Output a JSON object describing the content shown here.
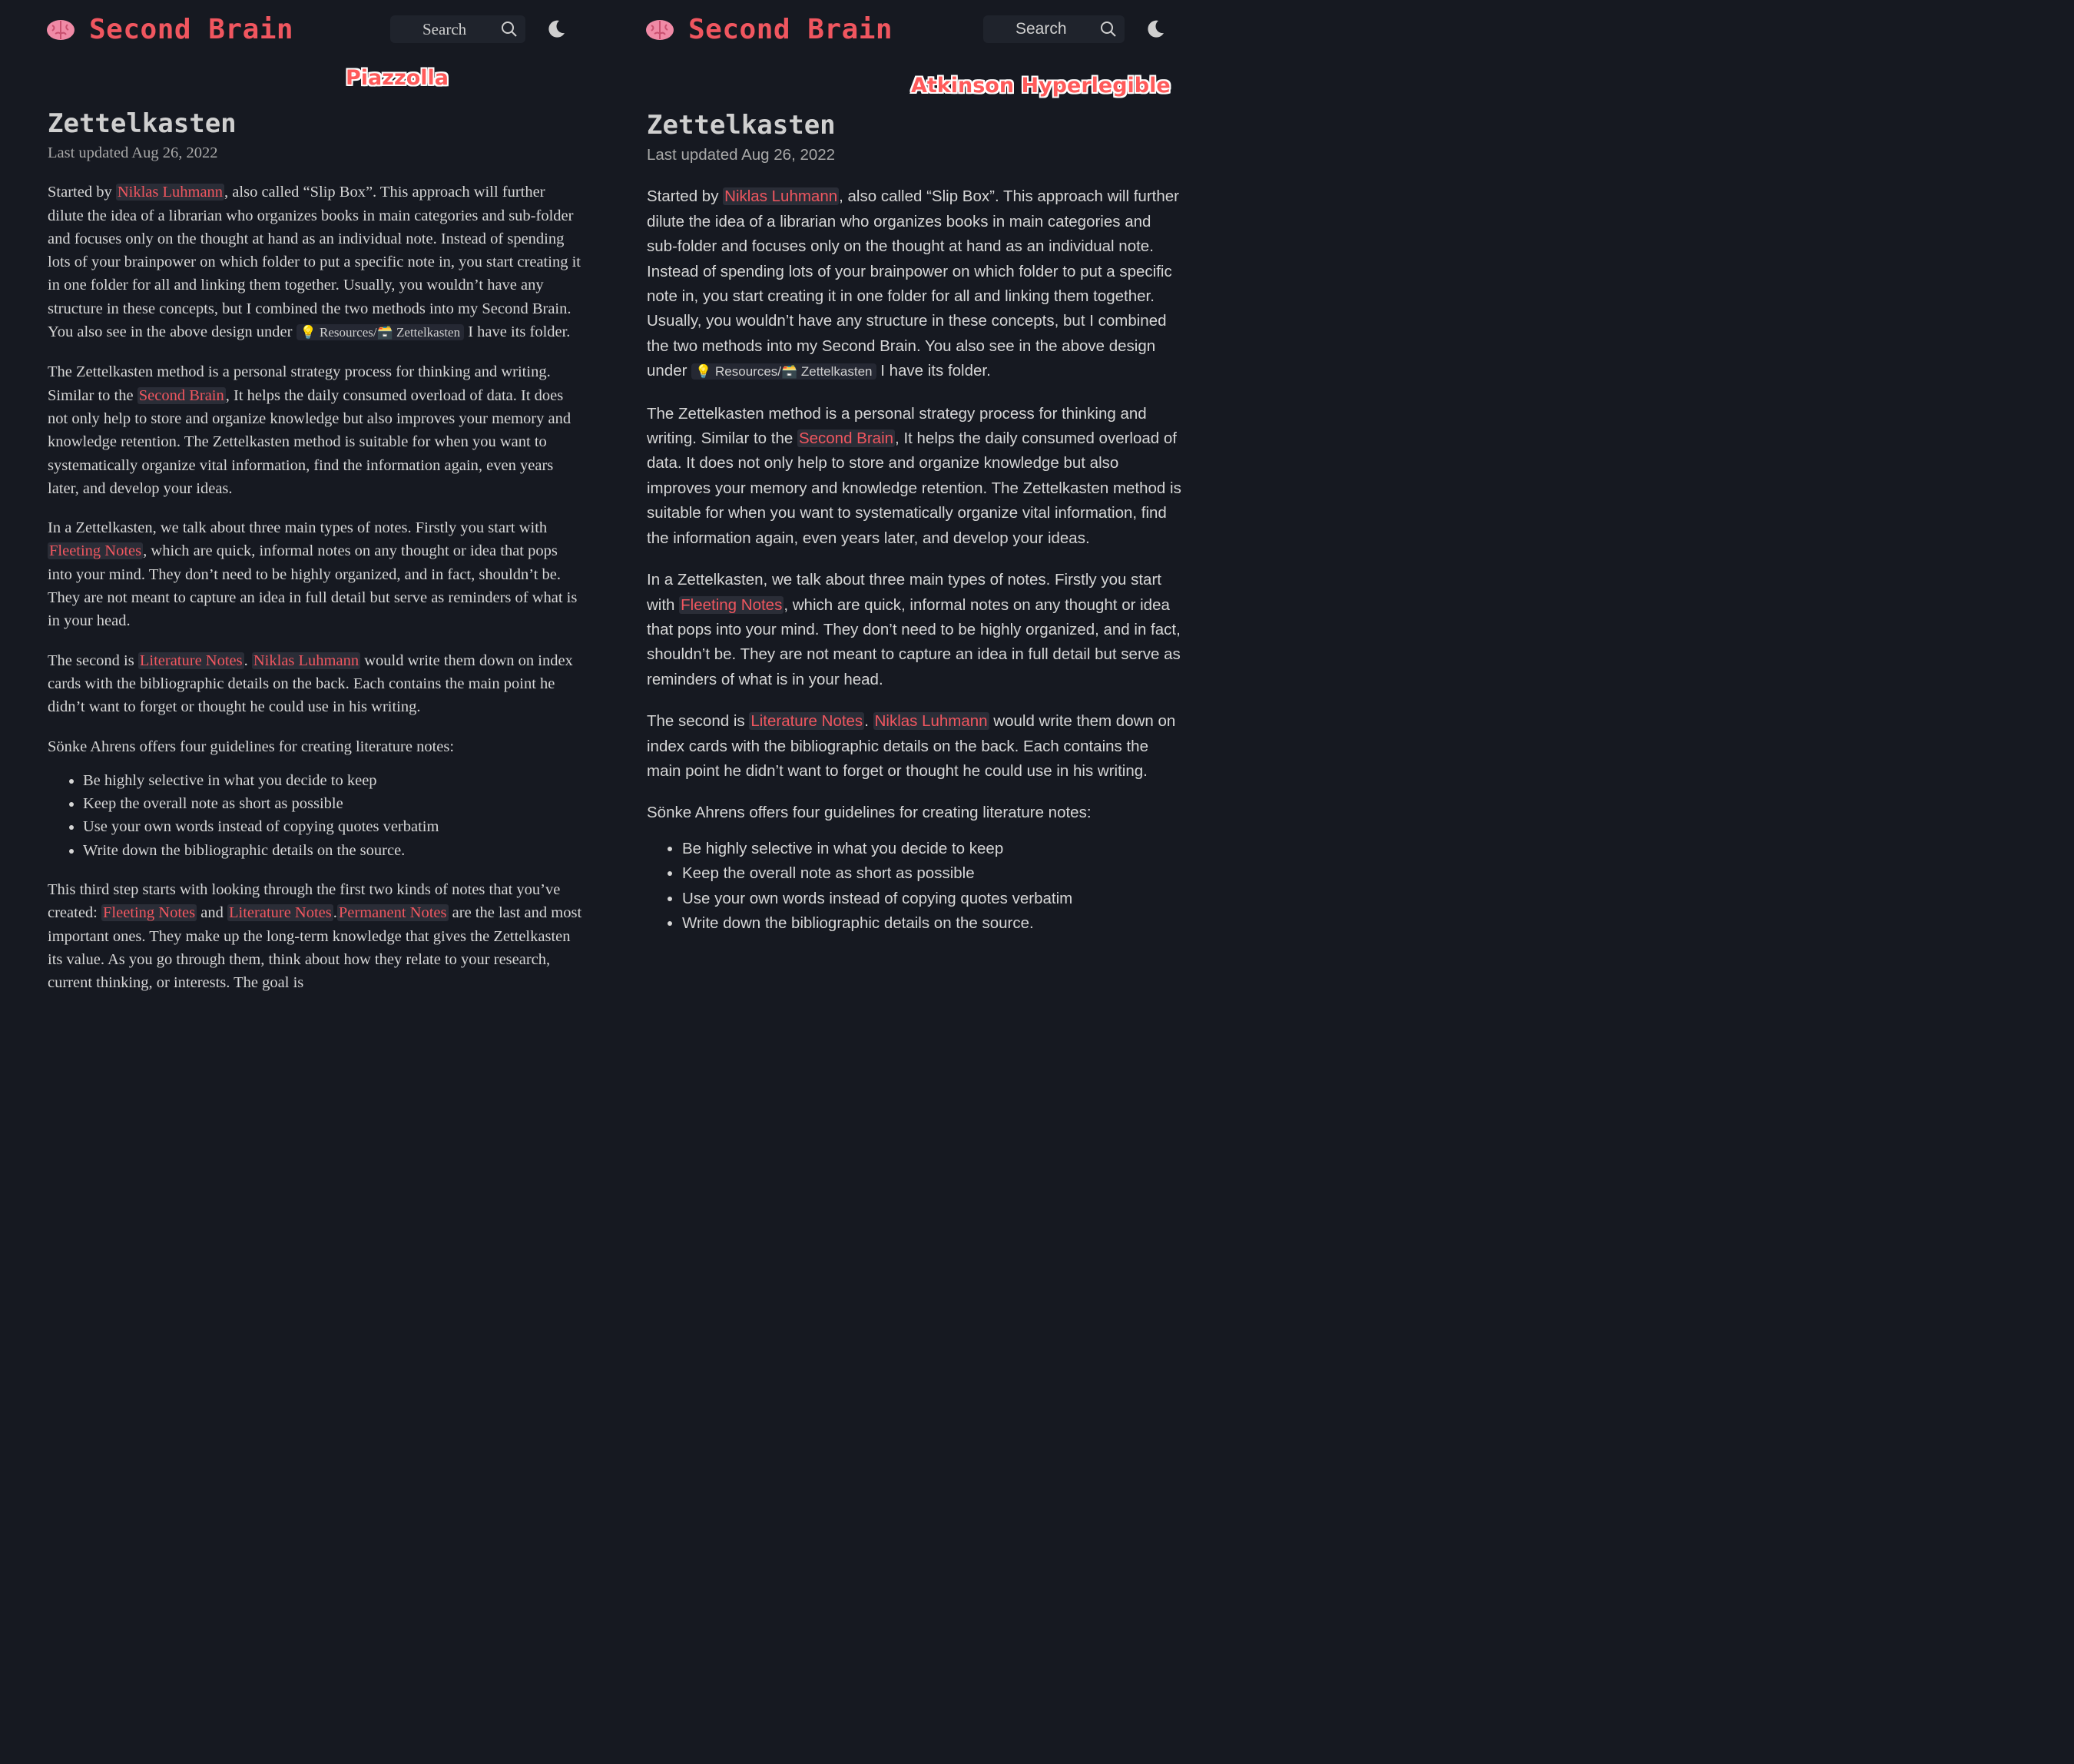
{
  "brand_title": "Second Brain",
  "search_label": "Search",
  "accent": "#f0565f",
  "background": "#161921",
  "panels": [
    {
      "font_tag": "Piazzolla",
      "title": "Zettelkasten",
      "updated": "Last updated Aug 26, 2022"
    },
    {
      "font_tag": "Atkinson Hyperlegible",
      "title": "Zettelkasten",
      "updated": "Last updated Aug 26, 2022"
    }
  ],
  "article": {
    "p1": {
      "t1": "Started by ",
      "l1": "Niklas Luhmann",
      "t2": ", also called “Slip Box”. This approach will further dilute the idea of a librarian who organizes books in main categories and sub-folder and focuses only on the thought at hand as an individual note. Instead of spending lots of your brainpower on which folder to put a specific note in, you start creating it in one folder for all and linking them together. Usually, you wouldn’t have any structure in these concepts, but I combined the two methods into my Second Brain. You also see in the above design under ",
      "code": "💡 Resources/🗃️ Zettelkasten",
      "t3": " I have its folder."
    },
    "p2": {
      "t1": "The Zettelkasten method is a personal strategy process for thinking and writing. Similar to the ",
      "l1": "Second Brain",
      "t2": ", It helps the daily consumed overload of data. It does not only help to store and organize knowledge but also improves your memory and knowledge retention. The Zettelkasten method is suitable for when you want to systematically organize vital information, find the information again, even years later, and develop your ideas."
    },
    "p3": {
      "t1": "In a Zettelkasten, we talk about three main types of notes. Firstly you start with ",
      "l1": "Fleeting Notes",
      "t2": ", which are quick, informal notes on any thought or idea that pops into your mind. They don’t need to be highly organized, and in fact, shouldn’t be. They are not meant to capture an idea in full detail but serve as reminders of what is in your head."
    },
    "p4": {
      "t1": "The second is ",
      "l1": "Literature Notes",
      "t2": ". ",
      "l2": "Niklas Luhmann",
      "t3": " would write them down on index cards with the bibliographic details on the back. Each contains the main point he didn’t want to forget or thought he could use in his writing."
    },
    "p5": "Sönke Ahrens offers four guidelines for creating literature notes:",
    "list": [
      "Be highly selective in what you decide to keep",
      "Keep the overall note as short as possible",
      "Use your own words instead of copying quotes verbatim",
      "Write down the bibliographic details on the source."
    ],
    "p6": {
      "t1": "This third step starts with looking through the first two kinds of notes that you’ve created: ",
      "l1": "Fleeting Notes",
      "t2": " and ",
      "l2": "Literature Notes",
      "t3": ".",
      "l3": "Permanent Notes",
      "t4": " are the last and most important ones. They make up the long-term knowledge that gives the Zettelkasten its value. As you go through them, think about how they relate to your research, current thinking, or interests. The goal is"
    }
  }
}
